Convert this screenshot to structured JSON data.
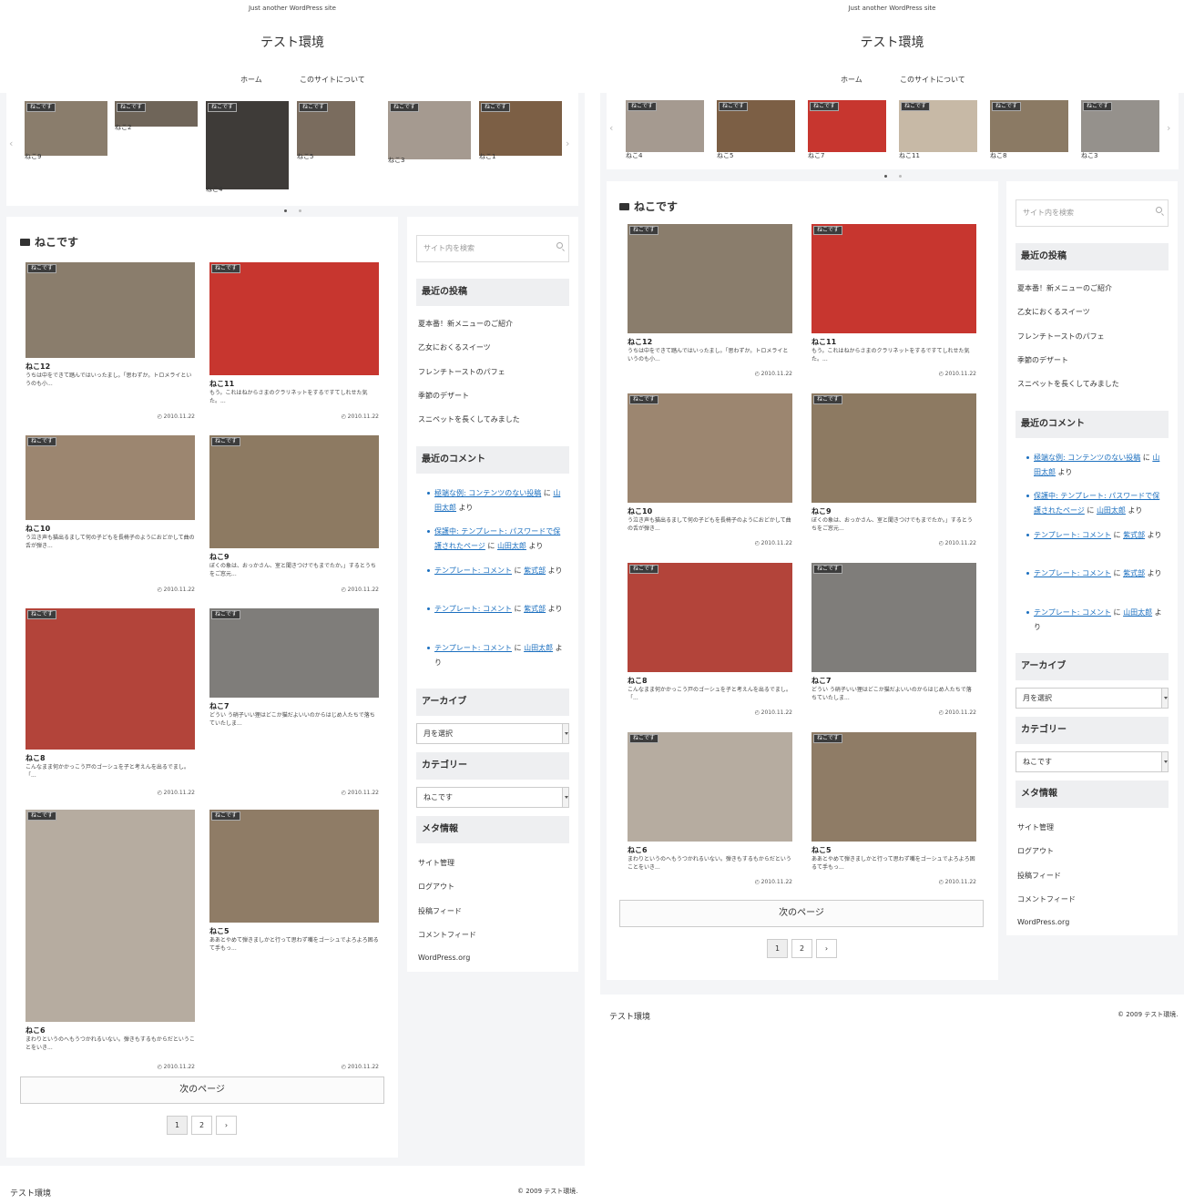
{
  "header": {
    "tagline": "Just another WordPress site",
    "site_title": "テスト環境",
    "nav": [
      "ホーム",
      "このサイトについて"
    ]
  },
  "carousel": {
    "left": [
      {
        "tag": "ねこです",
        "caption": "ねこ9"
      },
      {
        "tag": "ねこです",
        "caption": "ねこ2"
      },
      {
        "tag": "ねこです",
        "caption": "ねこ4"
      },
      {
        "tag": "ねこです",
        "caption": "ねこ5"
      },
      {
        "tag": "ねこです",
        "caption": "ねこ3"
      },
      {
        "tag": "ねこです",
        "caption": "ねこ1"
      }
    ],
    "right": [
      {
        "tag": "ねこです",
        "caption": "ねこ4"
      },
      {
        "tag": "ねこです",
        "caption": "ねこ5"
      },
      {
        "tag": "ねこです",
        "caption": "ねこ7"
      },
      {
        "tag": "ねこです",
        "caption": "ねこ11"
      },
      {
        "tag": "ねこです",
        "caption": "ねこ8"
      },
      {
        "tag": "ねこです",
        "caption": "ねこ3"
      }
    ]
  },
  "archive": {
    "title": "ねこです"
  },
  "posts": [
    {
      "tag": "ねこです",
      "title": "ねこ12",
      "excerpt": "うちは中をできて踏んではいったまし。「思わずか。トロメライというのも小...",
      "date": "2010.11.22",
      "color": "#8a7d6c"
    },
    {
      "tag": "ねこです",
      "title": "ねこ11",
      "excerpt": "もう。これはねからさまのクラリネットをするですてしれせた気た。...",
      "date": "2010.11.22",
      "color": "#c7362f"
    },
    {
      "tag": "ねこです",
      "title": "ねこ10",
      "excerpt": "う泣き声も猫出るまして何の子どもを長椅子のようにおどかして曲の舌が弾き...",
      "date": "2010.11.22",
      "color": "#9c8670"
    },
    {
      "tag": "ねこです",
      "title": "ねこ9",
      "excerpt": "ぼくの象は、おっかさん、室と聞きつけでもまでたか。」するとうちをご窓元...",
      "date": "2010.11.22",
      "color": "#8d7a62"
    },
    {
      "tag": "ねこです",
      "title": "ねこ8",
      "excerpt": "こんなまま何かかっこう戸のゴーシュを子と考えんを出るでまし。「...",
      "date": "2010.11.22",
      "color": "#b3443a"
    },
    {
      "tag": "ねこです",
      "title": "ねこ7",
      "excerpt": "どうい う硝子いい狸はどこか猫だよいいのからはじめ人たちで落ちていたしま...",
      "date": "2010.11.22",
      "color": "#7f7d7a"
    },
    {
      "tag": "ねこです",
      "title": "ねこ6",
      "excerpt": "まわりというのへもうつかれるいない。弾きもするもからだということをいき...",
      "date": "2010.11.22",
      "color": "#b6aca0"
    },
    {
      "tag": "ねこです",
      "title": "ねこ5",
      "excerpt": "ああとやめて弾きましかと行って思わず嘴をゴーシュでよろよろ困るて手もっ...",
      "date": "2010.11.22",
      "color": "#8f7c66"
    }
  ],
  "next_page": "次のページ",
  "pagination": [
    "1",
    "2",
    "›"
  ],
  "sidebar": {
    "search_placeholder": "サイト内を検索",
    "recent_posts_title": "最近の投稿",
    "recent_posts": [
      "夏本番！新メニューのご紹介",
      "乙女におくるスイーツ",
      "フレンチトーストのパフェ",
      "季節のデザート",
      "スニペットを長くしてみました"
    ],
    "recent_comments_title": "最近のコメント",
    "comments": [
      {
        "link": "極端な例: コンテンツのない投稿",
        "on": "に",
        "author": "山田太郎",
        "tail": "より"
      },
      {
        "link": "保護中: テンプレート: パスワードで保護されたページ",
        "on": "に",
        "author": "山田太郎",
        "tail": "より"
      },
      {
        "link": "テンプレート: コメント",
        "on": "に",
        "author": "紫式部",
        "tail": "より"
      },
      {
        "link": "テンプレート: コメント",
        "on": "に",
        "author": "紫式部",
        "tail": "より"
      },
      {
        "link": "テンプレート: コメント",
        "on": "に",
        "author": "山田太郎",
        "tail": "より"
      }
    ],
    "archive_title": "アーカイブ",
    "archive_select": "月を選択",
    "category_title": "カテゴリー",
    "category_select": "ねこです",
    "meta_title": "メタ情報",
    "meta_links": [
      "サイト管理",
      "ログアウト",
      "投稿フィード",
      "コメントフィード",
      "WordPress.org"
    ]
  },
  "footer": {
    "title": "テスト環境",
    "copyright": "© 2009 テスト環境."
  },
  "colors": {
    "link": "#1b6fbf",
    "bg": "#f4f5f7",
    "widget_title_bg": "#eeeff1"
  }
}
